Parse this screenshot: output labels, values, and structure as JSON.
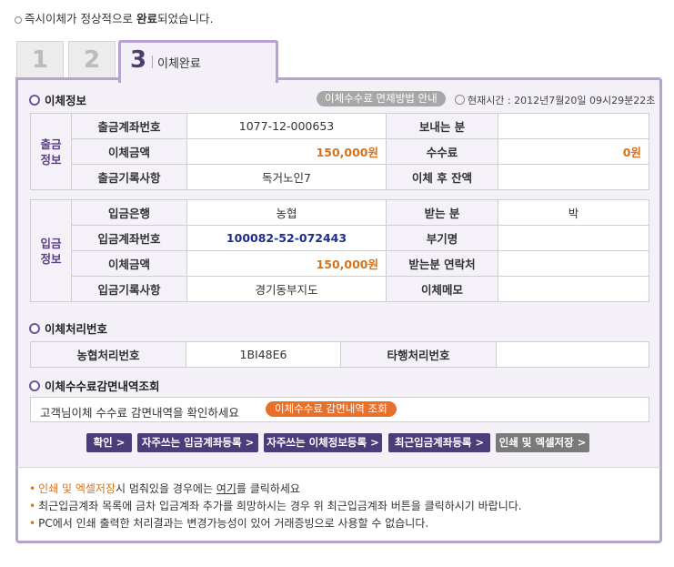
{
  "top_message": {
    "prefix": "즉시이체가 정상적으로 ",
    "bold": "완료",
    "suffix": "되었습니다."
  },
  "tabs": [
    "1",
    "2",
    "3"
  ],
  "tab3_label": "이체완료",
  "transfer_info": {
    "title": "이체정보",
    "fee_exempt_button": "이체수수료 면제방법 안내",
    "current_time": "현재시간 : 2012년7월20일 09시29분22초",
    "withdraw": {
      "group": [
        "출금",
        "정보"
      ],
      "rows": [
        [
          "출금계좌번호",
          "1077-12-000653",
          "보내는 분",
          ""
        ],
        [
          "이체금액",
          "150,000원",
          "수수료",
          "0원"
        ],
        [
          "출금기록사항",
          "독거노인7",
          "이체 후 잔액",
          ""
        ]
      ]
    },
    "deposit": {
      "group": [
        "입금",
        "정보"
      ],
      "rows": [
        [
          "입금은행",
          "농협",
          "받는 분",
          "박"
        ],
        [
          "입금계좌번호",
          "100082-52-072443",
          "부기명",
          ""
        ],
        [
          "이체금액",
          "150,000원",
          "받는분 연락처",
          ""
        ],
        [
          "입금기록사항",
          "경기동부지도",
          "이체메모",
          ""
        ]
      ]
    }
  },
  "process_no": {
    "title": "이체처리번호",
    "row": [
      "농협처리번호",
      "1BI48E6",
      "타행처리번호",
      ""
    ]
  },
  "fee_lookup": {
    "title": "이체수수료감면내역조회",
    "text": "고객님이체 수수료 감면내역을 확인하세요",
    "button": "이체수수료 감면내역 조회"
  },
  "actions": [
    "확인 >",
    "자주쓰는 입금계좌등록 >",
    "자주쓰는 이체정보등록 >",
    "최근입금계좌등록 >",
    "인쇄 및 엑셀저장 >"
  ],
  "notes": {
    "n1_hl": "인쇄 및 엑셀저장",
    "n1_mid": "시 멈춰있을 경우에는 ",
    "n1_link": "여기",
    "n1_end": "를 클릭하세요",
    "n2": "최근입금계좌 목록에 금차 입금계좌 추가를 희망하시는 경우 위 최근입금계좌 버튼을 클릭하시기 바랍니다.",
    "n3": "PC에서 인쇄 출력한 처리결과는 변경가능성이 있어 거래증빙으로 사용할 수 없습니다."
  },
  "colors": {
    "accent": "#4a3d7a",
    "border": "#b6a3d2",
    "orange": "#d2731f"
  }
}
